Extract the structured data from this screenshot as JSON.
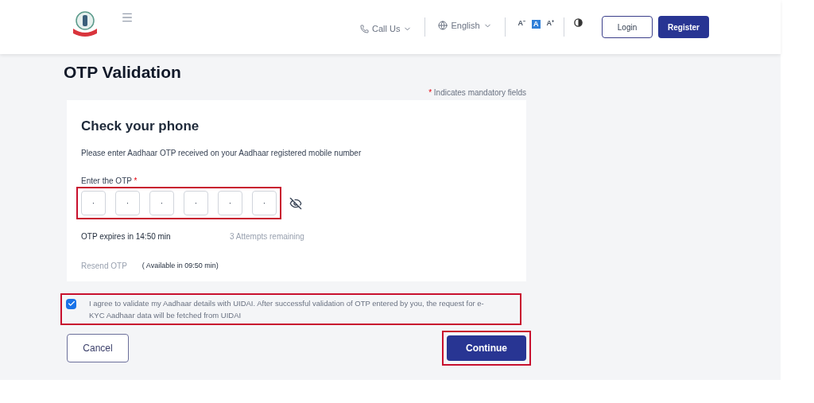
{
  "header": {
    "call_us": "Call Us",
    "language": "English",
    "font_sizes": [
      {
        "label": "A⁻",
        "selected": false
      },
      {
        "label": "A",
        "selected": true
      },
      {
        "label": "A⁺",
        "selected": false
      }
    ],
    "login": "Login",
    "register": "Register"
  },
  "page_title": "OTP Validation",
  "mandatory_note": {
    "star": "*",
    "text": "Indicates mandatory fields"
  },
  "card": {
    "title": "Check your phone",
    "instruction": "Please enter Aadhaar OTP received on your Aadhaar registered mobile number",
    "otp_label": "Enter the OTP",
    "otp_star": "*",
    "otp_digits": [
      "·",
      "·",
      "·",
      "·",
      "·",
      "·"
    ],
    "otp_hidden": true,
    "expiry": "OTP expires in 14:50 min",
    "attempts": "3 Attempts remaining",
    "resend": "Resend OTP",
    "resend_disabled": true,
    "availability": "( Available in 09:50 min)"
  },
  "consent": {
    "checked": true,
    "text": "I agree to validate my Aadhaar details with UIDAI. After successful validation of OTP entered by you, the request for e-KYC Aadhaar data will be fetched from UIDAI"
  },
  "buttons": {
    "cancel": "Cancel",
    "continue": "Continue"
  }
}
